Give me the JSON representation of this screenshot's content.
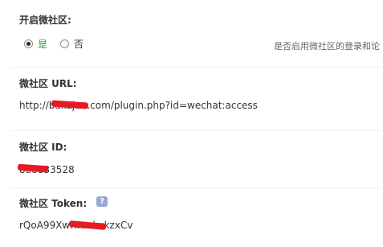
{
  "community_toggle": {
    "label": "开启微社区:",
    "options": [
      {
        "label": "是",
        "checked": true
      },
      {
        "label": "否",
        "checked": false
      }
    ],
    "hint": "是否启用微社区的登录和论"
  },
  "community_url": {
    "label": "微社区 URL:",
    "value": "http://bakajun.com/plugin.php?id=wechat:access"
  },
  "community_id": {
    "label": "微社区 ID:",
    "value": "888833528"
  },
  "community_token": {
    "label": "微社区 Token:",
    "value": "rQoA99XwHhmkxkzxCv",
    "help_icon": "question-help-icon"
  },
  "colors": {
    "selected_option": "#2aa32a",
    "redaction": "#e51b24",
    "help_icon_bg": "#9aa6d3",
    "separator": "#eef0f3"
  }
}
